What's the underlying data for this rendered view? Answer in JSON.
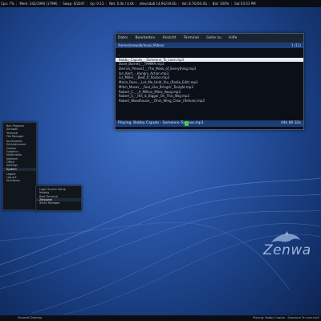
{
  "topbar": {
    "items": [
      "Cpu: 7%",
      "Mem: 342/1990 (179M)",
      "Swap: 0/2047",
      "Up: 0:13",
      "Net: 0.0k / 0.0k",
      "/dev/sda6 14.9G/19.6G",
      "Vol: 8.7G/50.4G",
      "Bat: 100%",
      "Sat 03:53 PM"
    ]
  },
  "terminal": {
    "menu": [
      "Datei",
      "Bearbeiten",
      "Ansicht",
      "Terminal",
      "Gehe zu",
      "Hilfe"
    ],
    "path": "/home/zenwalk/music/Alben/",
    "count": "1 (11)",
    "files": [
      "..",
      "Bobby_Caputo_-_Someone_To_Love.mp3",
      "Dave_Barrett_-_TAMMA.mp3",
      "Derrick_Prevost_-_The_Mask_of_Everything.mp3",
      "Ian_Kent_-_Hungry_Action.mp3",
      "Liz_Miller_-_Beat_It_Rocker.mp3",
      "Maria_Rose_-_Let_Me_Hold_You_(Radio_Edit).mp3",
      "Mitch_Moses_-_Feel_Like_Bringin'_Tonight.mp3",
      "Robert_C._-_A_Million_Miles_Away.mp3",
      "Robert_S_-_Hill_Is_Bigger_On_This_Way.mp3",
      "Robert_Woodhouse_-_Ohm_Wing_Clear_(Refuse).mp3"
    ],
    "selected_index": 1,
    "status": "Playing: Bobby Caputo - Someone To Love.mp3",
    "status_right": "44k 80 32s"
  },
  "main_menu": {
    "items": [
      "Run Program",
      "Zenwalk",
      "Terminal",
      "File Manager",
      "",
      "Accessories",
      "Entertainment",
      "Games",
      "Graphics",
      "Multimedia",
      "Network",
      "Office",
      "Settings",
      "System",
      "",
      "Logout",
      "Log out",
      "Shutdown"
    ],
    "active": "System"
  },
  "sub_menu": {
    "items": [
      "Login Screen Setup",
      "Netpkg",
      "Root Terminal",
      "Zenpanel",
      "Xfce4 Manager"
    ],
    "active": "Zenpanel"
  },
  "bottombar": {
    "left": "Zenwalk Desktop",
    "right": "Playing: Bobby Caputo - Someone To Love.mp3"
  },
  "branding": {
    "logo_text": "Zenwa"
  },
  "colors": {
    "terminal_bar": "#1c3d78",
    "cursor": "#3ecf4a"
  }
}
